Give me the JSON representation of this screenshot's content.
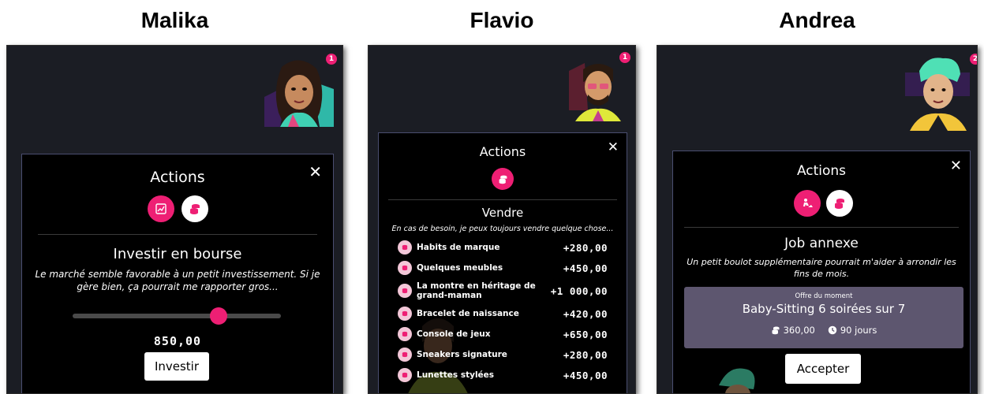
{
  "columns": [
    {
      "player": "Malika",
      "notification_count": "1",
      "modal": {
        "title": "Actions",
        "section_title": "Investir en bourse",
        "description": "Le marché semble favorable à un petit investissement. Si je gère bien, ça pourrait me rapporter gros...",
        "amount": "850,00",
        "slider_value": 0.7,
        "button_label": "Investir"
      }
    },
    {
      "player": "Flavio",
      "notification_count": "1",
      "modal": {
        "title": "Actions",
        "section_title": "Vendre",
        "description": "En cas de besoin, je peux toujours vendre quelque chose...",
        "items": [
          {
            "label": "Habits de marque",
            "price": "+280,00"
          },
          {
            "label": "Quelques meubles",
            "price": "+450,00"
          },
          {
            "label": "La montre en héritage de grand-maman",
            "price": "+1 000,00"
          },
          {
            "label": "Bracelet de naissance",
            "price": "+420,00"
          },
          {
            "label": "Console de jeux",
            "price": "+650,00"
          },
          {
            "label": "Sneakers signature",
            "price": "+280,00"
          },
          {
            "label": "Lunettes stylées",
            "price": "+450,00"
          }
        ]
      }
    },
    {
      "player": "Andrea",
      "notification_count": "2",
      "modal": {
        "title": "Actions",
        "section_title": "Job annexe",
        "description": "Un petit boulot supplémentaire pourrait m'aider à arrondir les fins de mois.",
        "offer": {
          "caption": "Offre du moment",
          "title": "Baby-Sitting 6 soirées sur 7",
          "money": "360,00",
          "duration": "90 jours"
        },
        "button_label": "Accepter"
      }
    }
  ],
  "colors": {
    "accent": "#ee1f74",
    "phone_bg": "#1b1d24",
    "modal_bg": "#000000",
    "offer_bg": "#5d566f"
  }
}
